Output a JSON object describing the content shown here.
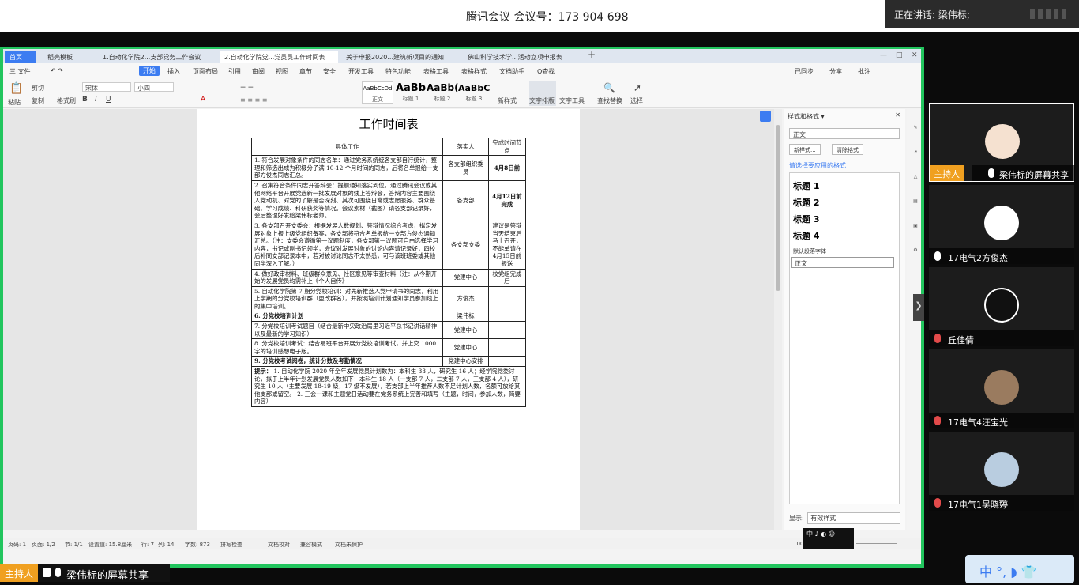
{
  "meeting": {
    "title": "腾讯会议 会议号：173 904 698",
    "speaking": "正在讲话: 梁伟标;",
    "host_tag": "主持人",
    "share_label": "梁伟标的屏幕共享"
  },
  "wps": {
    "tabs": [
      "首页",
      "稻壳模板",
      "1.自动化学院2...支部党务工作会议",
      "2.自动化学院党...党员员工作时间表",
      "关于申报2020...建筑新项目的通知",
      "佛山科学技术学...活动立项申报表"
    ],
    "menu": [
      "三 文件",
      "开始",
      "插入",
      "页面布局",
      "引用",
      "审阅",
      "视图",
      "章节",
      "安全",
      "开发工具",
      "特色功能",
      "表格工具",
      "表格样式",
      "文档助手",
      "Q查找"
    ],
    "menu_right": [
      "已同步",
      "分享",
      "批注"
    ],
    "font_name": "宋体",
    "font_size": "小四",
    "styles": [
      {
        "preview": "AaBbCcDd",
        "label": "正文"
      },
      {
        "preview": "AaBb",
        "label": "标题 1"
      },
      {
        "preview": "AaBb(",
        "label": "标题 2"
      },
      {
        "preview": "AaBbC",
        "label": "标题 3"
      }
    ],
    "ribbon_right": [
      "新样式",
      "文字排版",
      "文字工具",
      "查找替换",
      "选择"
    ],
    "ribbon_left": [
      "粘贴",
      "剪切",
      "复制",
      "格式刷"
    ]
  },
  "doc": {
    "title": "工作时间表",
    "headers": [
      "具体工作",
      "落实人",
      "完成时间节点"
    ],
    "rows": [
      {
        "work": "1. 符合发展对象条件的同志名单：通过党务系统统各支部自行统计，整理和筛选出成为积极分子满 10-12 个月时间的同志，后将名单报给一支部方俊杰同志汇总。",
        "person": "各支部组织委员",
        "time": "4月8日前"
      },
      {
        "work": "2. 召集符合条件同志开答辩会：提前通知落实到位，通过腾讯会议或其他网络平台开展党选新一批发展对象的线上答辩会，答辩内容主要围绕入党动机、对党的了解是否深刻、其次可围绕日常或志愿服务、群众基础、学习成绩、科研获奖等情况。会议素材（截图）请各支部记录好，会后整理好发给梁伟标老师。",
        "person": "各支部",
        "time": "4月12日前完成"
      },
      {
        "work": "3. 各支部召开支委会：根据发展人数规划、答辩情况综合考虑，拟定发展对象上报上级党组织备案，各支部将符合名单报给一支部方俊杰通知汇总。（注：支委会遵循第一议题制度，各支部第一议题可自由选择学习内容，书记或副书记领学，会议对发展对象的讨论内容请记录好，四校后补同支部记录本中，若对被讨论同志不太熟悉，可与该班班委或其他同学深入了解。）",
        "person": "各支部支委",
        "time": "建议是答辩当天结束后马上召开，不能单请在 4月15日前报送"
      },
      {
        "work": "4. 做好政审材料、班级群众意见、社区意见等审查材料（注：从今期开始的发展党员均需补上《个人自传》",
        "person": "党建中心",
        "time": "校党组完成后"
      },
      {
        "work": "5. 自动化学院第 7 期分党校培训：对先新推选入党申请书的同志，利用上学期的分党校培训群（更改群名），并按照培训计划通知学员参加线上的集中培训。",
        "person": "方俊杰",
        "time": ""
      },
      {
        "work": "6. 分党校培训计划",
        "person": "梁伟标",
        "time": ""
      },
      {
        "work": "7. 分党校培训考试题目（结合最新中央政治局里习近平总书记讲话精神以及最新的学习知识）",
        "person": "党建中心",
        "time": ""
      },
      {
        "work": "8. 分党校培训考试：结合易班平台开展分党校培训考试，并上交 1000 字的培训感想电子版。",
        "person": "党建中心",
        "time": ""
      },
      {
        "work": "9. 分党校考试阅卷，统计分数及考勤情况",
        "person": "党建中心安排",
        "time": ""
      }
    ],
    "tips_title": "提示：",
    "tips": "1. 自动化学院 2020 年全年发展党员计划数为：本科生 33 人，研究生 16 人；经学院党委讨论，拟于上半年计划发展党员人数如下：本科生 18 人（一支部 7 人，二支部 7 人，三支部 4 人），研究生 10 人（主要发展 18-19 级，17 级不发展），若支部上半年推荐人数不足计划人数，名额可放给其他支部或留空。 2. 三会一课和主题党日活动要在党务系统上完善和填写（主题，时间，参加人数，简要内容）"
  },
  "stylepane": {
    "title": "样式和格式 ▾",
    "current": "正文",
    "buttons": [
      "新样式...",
      "清除格式"
    ],
    "hint": "请选择要应用的格式",
    "items": [
      "标题 1",
      "标题 2",
      "标题 3",
      "标题 4"
    ],
    "default_font": "默认段落字体",
    "body": "正文",
    "show_label": "显示:",
    "show_value": "有效样式"
  },
  "status": {
    "page": "页码: 1",
    "pages": "页面: 1/2",
    "section": "节: 1/1",
    "setting": "设置值: 15.8厘米",
    "row": "行: 7",
    "col": "列: 14",
    "words": "字数: 873",
    "spell": "拼写检查",
    "proof": "文档校对",
    "compat": "兼容模式",
    "protect": "文档未保护",
    "zoom": "100%"
  },
  "ime": {
    "mini": "中 ♪ ◐ ☺",
    "float": "中 °, ◗ 👕"
  },
  "participants": [
    {
      "name": "梁伟标的屏幕共享",
      "host": true,
      "muted": false,
      "avatar_color": "#f5e1d0"
    },
    {
      "name": "17电气2方俊杰",
      "host": false,
      "muted": false,
      "avatar_color": "#ffffff"
    },
    {
      "name": "丘佳倩",
      "host": false,
      "muted": true,
      "avatar_color": "#111111"
    },
    {
      "name": "17电气4汪宝光",
      "host": false,
      "muted": true,
      "avatar_color": "#9a7b5f"
    },
    {
      "name": "17电气1吴晓婷",
      "host": false,
      "muted": true,
      "avatar_color": "#b9cde0"
    }
  ]
}
